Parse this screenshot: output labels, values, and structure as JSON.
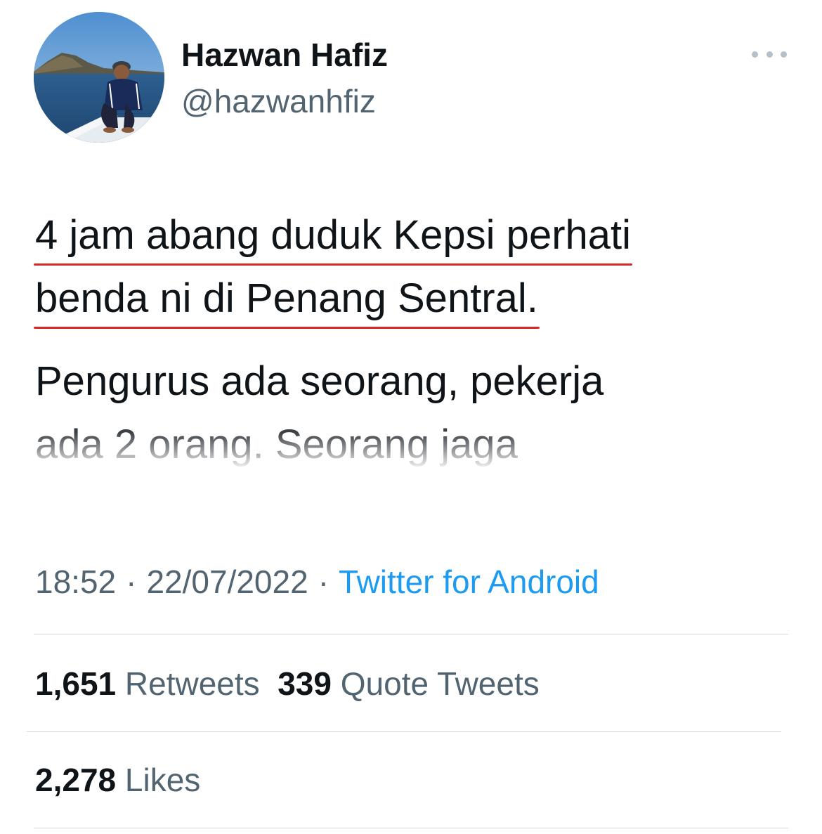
{
  "tweet": {
    "author": {
      "display_name": "Hazwan Hafiz",
      "handle": "@hazwanhfiz"
    },
    "more_icon": "more-horizontal-icon",
    "text_lines": [
      "4 jam abang duduk Kepsi perhati",
      "benda ni di Penang Sentral.",
      "Pengurus ada seorang, pekerja",
      "ada 2 orang. Seorang jaga"
    ],
    "highlight_color": "#d62828",
    "time": "18:52",
    "date": "22/07/2022",
    "separator": "·",
    "source": "Twitter for Android",
    "stats": {
      "retweets_count": "1,651",
      "retweets_label": "Retweets",
      "quotes_count": "339",
      "quotes_label": "Quote Tweets",
      "likes_count": "2,278",
      "likes_label": "Likes"
    },
    "colors": {
      "text": "#0f1419",
      "secondary": "#536471",
      "link": "#1d9bf0",
      "divider": "#cfd9de"
    }
  }
}
